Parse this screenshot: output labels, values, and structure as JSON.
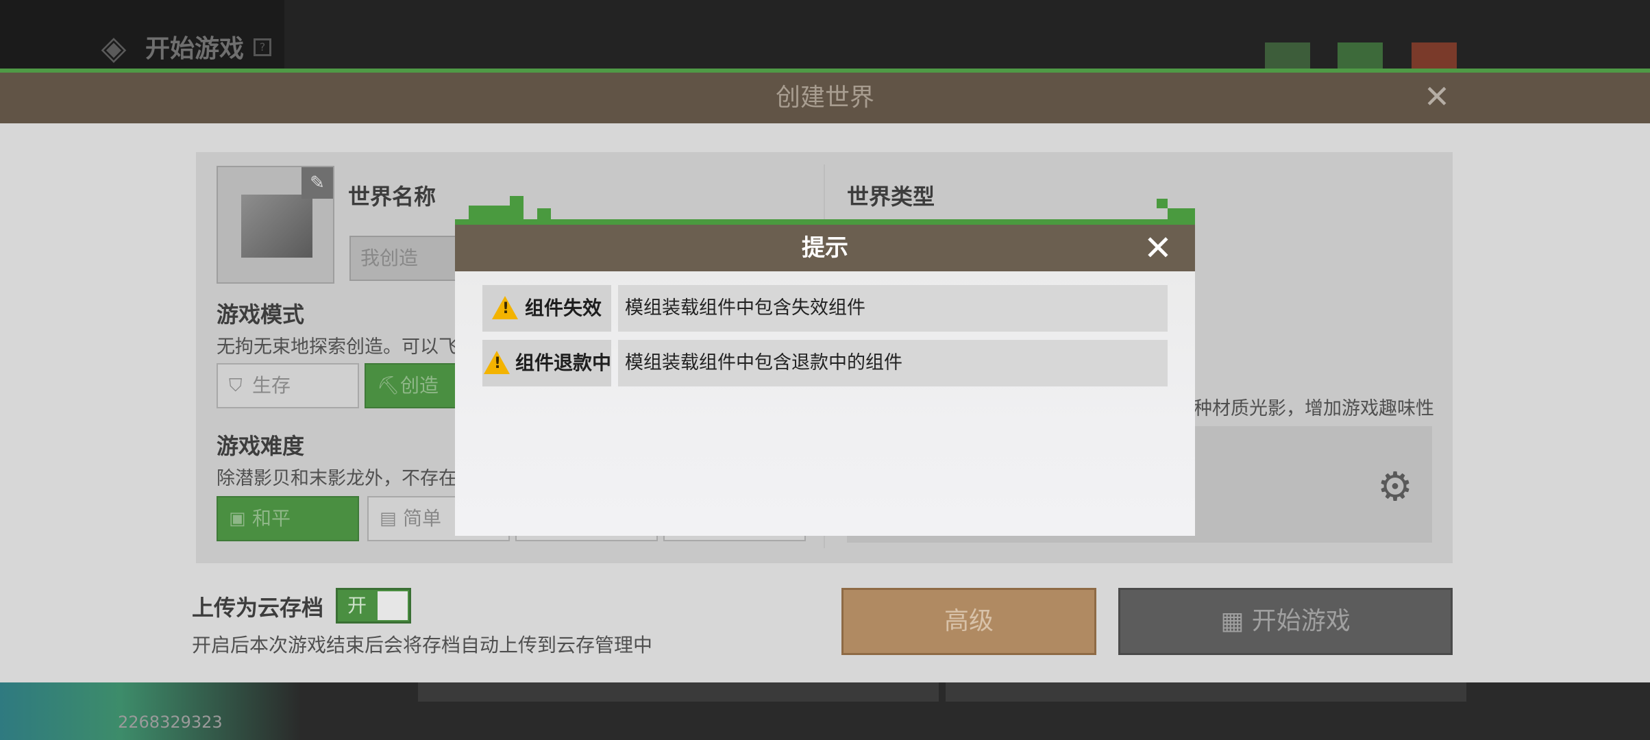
{
  "background": {
    "title": "开始游戏",
    "help_glyph": "?",
    "title_icon": "◈",
    "id_text": "2268329323"
  },
  "create_world": {
    "title": "创建世界",
    "close_glyph": "✕",
    "world_name_label": "世界名称",
    "world_name_value": "我创造",
    "world_type_label": "世界类型",
    "game_mode_label": "游戏模式",
    "game_mode_desc": "无拘无束地探索创造。可以飞",
    "mode_survival": "生存",
    "mode_creative": "创造",
    "difficulty_label": "游戏难度",
    "difficulty_desc": "除潜影贝和末影龙外，不存在",
    "diff_peaceful": "和平",
    "diff_easy": "简单",
    "right_desc": "种材质光影，增加游戏趣味性",
    "cloud_label": "上传为云存档",
    "cloud_toggle": "开",
    "cloud_desc": "开启后本次游戏结束后会将存档自动上传到云存管理中",
    "advanced_button": "高级",
    "start_button": "开始游戏",
    "pencil_glyph": "✎",
    "gear_glyph": "⚙",
    "survival_icon_glyph": "⛉",
    "creative_icon_glyph": "⛏",
    "peaceful_icon_glyph": "▣",
    "easy_icon_glyph": "▤",
    "start_icon_glyph": "▦"
  },
  "dialog": {
    "title": "提示",
    "close_glyph": "✕",
    "rows": [
      {
        "label": "组件失效",
        "message": "模组装载组件中包含失效组件",
        "icon": "warning-icon"
      },
      {
        "label": "组件退款中",
        "message": "模组装载组件中包含退款中的组件",
        "icon": "warning-icon"
      }
    ]
  },
  "colors": {
    "accent_green": "#4a9a3f",
    "header_brown": "#6b5f50",
    "warning_yellow": "#f3b300"
  }
}
